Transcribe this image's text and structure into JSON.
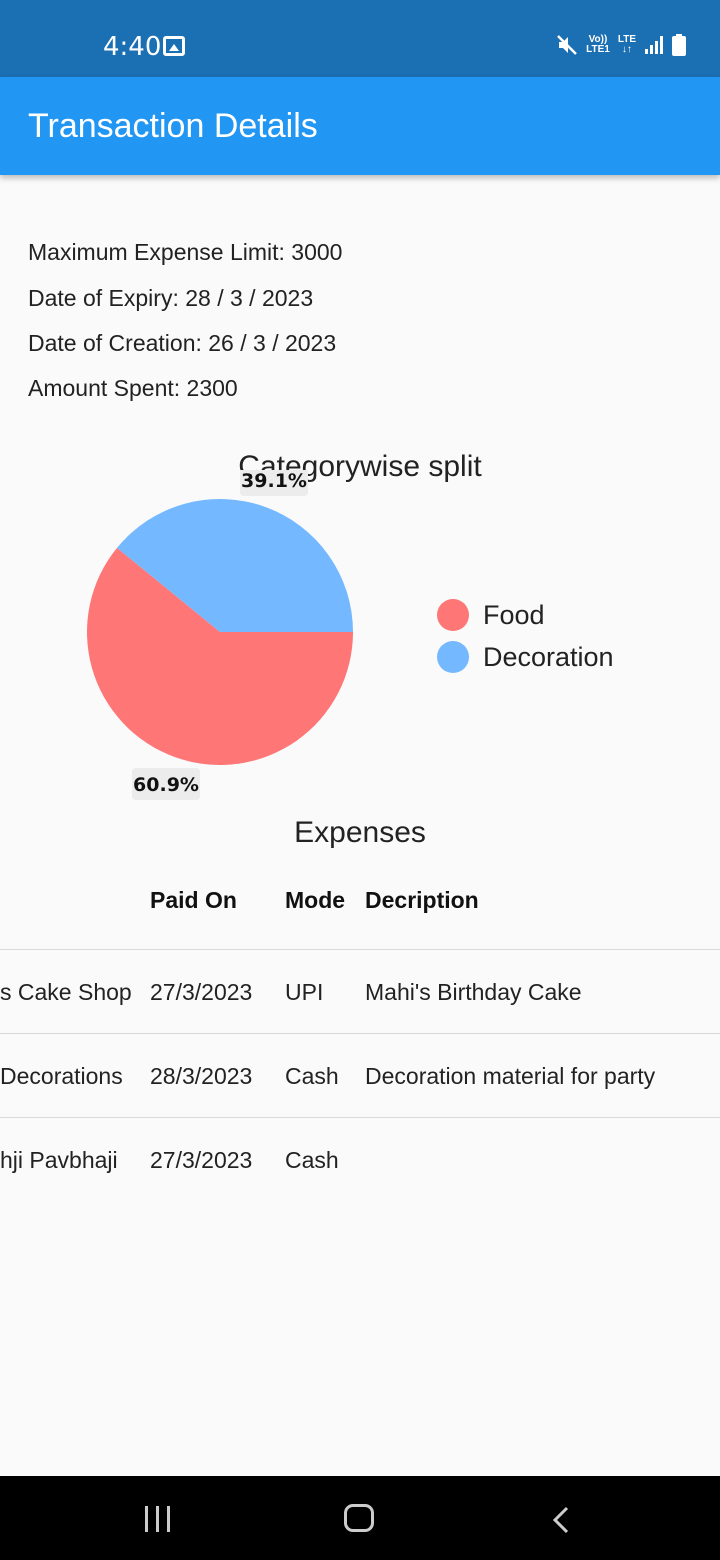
{
  "status_bar": {
    "time": "4:40",
    "volte_line1": "Vo))",
    "volte_line2": "LTE1",
    "lte": "LTE",
    "icons": [
      "image-icon",
      "mute-icon",
      "signal-icon",
      "battery-icon"
    ]
  },
  "app_bar": {
    "title": "Transaction Details",
    "color": "#2196f3"
  },
  "info": {
    "max_limit": "Maximum Expense Limit: 3000",
    "expiry": "Date of Expiry: 28 / 3 / 2023",
    "creation": "Date of Creation: 26 / 3 / 2023",
    "spent": "Amount Spent: 2300"
  },
  "chart_data": {
    "type": "pie",
    "title": "Categorywise split",
    "slices": [
      {
        "name": "Food",
        "percent": 60.9,
        "label": "60.9%",
        "color": "#ff7676"
      },
      {
        "name": "Decoration",
        "percent": 39.1,
        "label": "39.1%",
        "color": "#74b8ff"
      }
    ],
    "legend_placement": "right"
  },
  "expenses": {
    "title": "Expenses",
    "headers": {
      "paid_on": "Paid On",
      "mode": "Mode",
      "description": "Decription"
    },
    "rows": [
      {
        "vendor": "s Cake Shop",
        "paid_on": "27/3/2023",
        "mode": "UPI",
        "description": "Mahi's Birthday Cake"
      },
      {
        "vendor": "Decorations",
        "paid_on": "28/3/2023",
        "mode": "Cash",
        "description": "Decoration material for party"
      },
      {
        "vendor": "hji Pavbhaji",
        "paid_on": "27/3/2023",
        "mode": "Cash",
        "description": ""
      }
    ]
  },
  "nav_bar": {
    "icons": [
      "recent-apps-icon",
      "home-icon",
      "back-icon"
    ]
  }
}
